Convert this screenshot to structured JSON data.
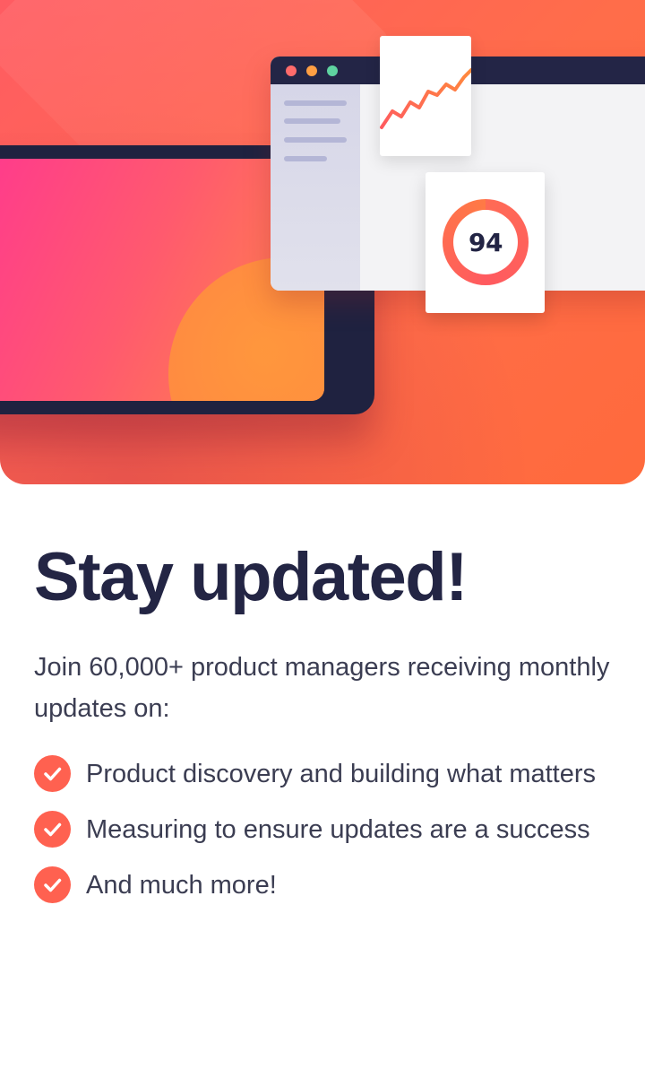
{
  "hero": {
    "score": "94"
  },
  "colors": {
    "accent": "#ff6150",
    "heading": "#232544",
    "body_text": "#3b3d52",
    "hero_gradient_start": "#ff5c62",
    "hero_gradient_end": "#ff6a3c",
    "dark_frame": "#1f2240"
  },
  "content": {
    "title": "Stay updated!",
    "intro": "Join 60,000+ product managers receiving monthly updates on:",
    "features": [
      {
        "icon": "check-circle-icon",
        "text": "Product discovery and building what matters"
      },
      {
        "icon": "check-circle-icon",
        "text": "Measuring to ensure updates are a success"
      },
      {
        "icon": "check-circle-icon",
        "text": "And much more!"
      }
    ]
  }
}
